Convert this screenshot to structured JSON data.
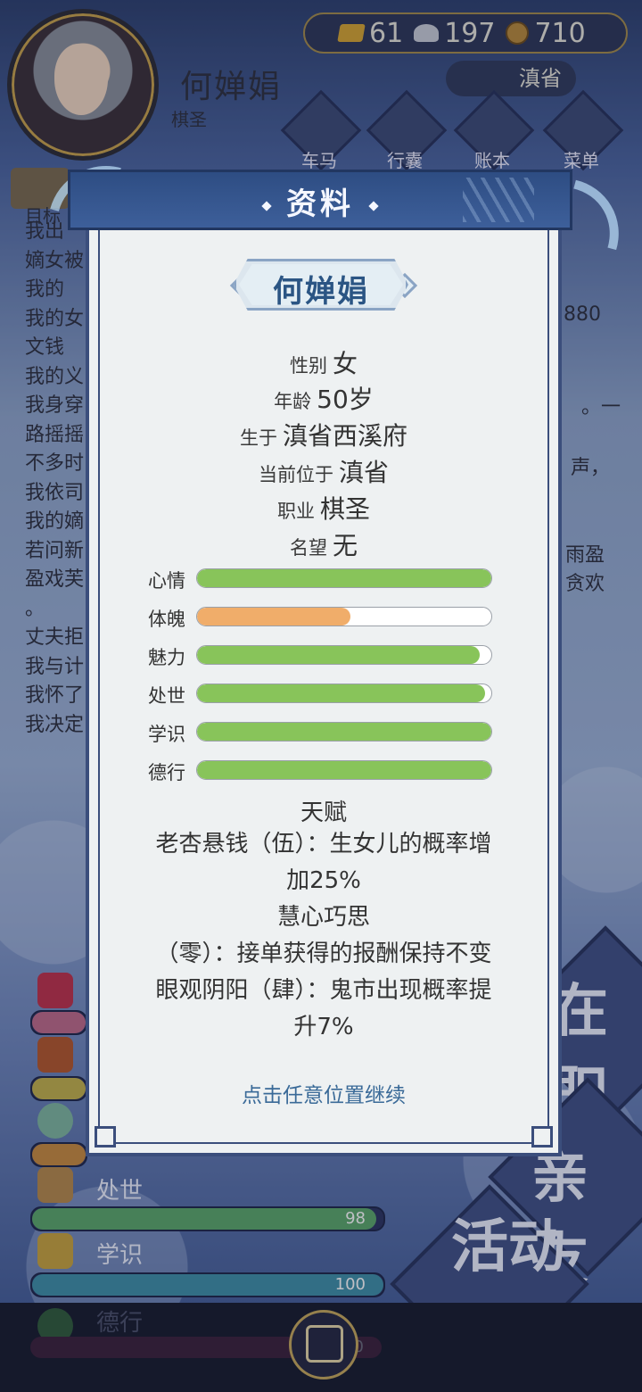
{
  "player": {
    "name": "何婵娟",
    "title": "棋圣"
  },
  "currency": {
    "gold": "61",
    "silver": "197",
    "copper": "710"
  },
  "location": "滇省",
  "top_menu": [
    "车马",
    "行囊",
    "账本",
    "菜单"
  ],
  "goal_label": "目标",
  "background_log": [
    "我出",
    "嫡女被",
    "我的",
    "我的女",
    "文钱",
    "我的义",
    "我身穿",
    "路摇摇",
    "不多时",
    "我依司",
    "我的嫡",
    "若问新",
    "盈戏芙",
    "。",
    "丈夫拒",
    "我与计",
    "我怀了",
    "我决定"
  ],
  "background_log_tails": {
    "line4": "880",
    "line7": "—",
    "line8": "。一",
    "line9": "声，",
    "line12": "雨盈",
    "line13": "贪欢"
  },
  "side_tags": [
    "在职",
    "亲友",
    "活动"
  ],
  "background_stats": [
    {
      "name": "处世",
      "value": "98"
    },
    {
      "name": "学识",
      "value": "100"
    },
    {
      "name": "德行",
      "value": "100"
    }
  ],
  "modal": {
    "title": "资料",
    "name": "何婵娟",
    "info": [
      {
        "key": "性别",
        "value": "女"
      },
      {
        "key": "年龄",
        "value": "50岁"
      },
      {
        "key": "生于",
        "value": "滇省西溪府"
      },
      {
        "key": "当前位于",
        "value": "滇省"
      },
      {
        "key": "职业",
        "value": "棋圣"
      },
      {
        "key": "名望",
        "value": "无"
      }
    ],
    "attributes": [
      {
        "name": "心情",
        "level": 1.0,
        "color": "#88c45a"
      },
      {
        "name": "体魄",
        "level": 0.52,
        "color": "#f0ad6a"
      },
      {
        "name": "魅力",
        "level": 0.96,
        "color": "#88c45a"
      },
      {
        "name": "处世",
        "level": 0.98,
        "color": "#88c45a"
      },
      {
        "name": "学识",
        "level": 1.0,
        "color": "#88c45a"
      },
      {
        "name": "德行",
        "level": 1.0,
        "color": "#88c45a"
      }
    ],
    "talent_heading": "天赋",
    "talents": [
      "老杏悬钱（伍）：生女儿的概率增",
      "加25%",
      "慧心巧思",
      "（零）：接单获得的报酬保持不变",
      "眼观阴阳（肆）：鬼市出现概率提",
      "升7%"
    ],
    "continue_hint": "点击任意位置继续"
  },
  "colors": {
    "header": "#2e4d83",
    "frame": "#3b4e7c",
    "bar_green": "#88c45a",
    "bar_orange": "#f0ad6a"
  }
}
